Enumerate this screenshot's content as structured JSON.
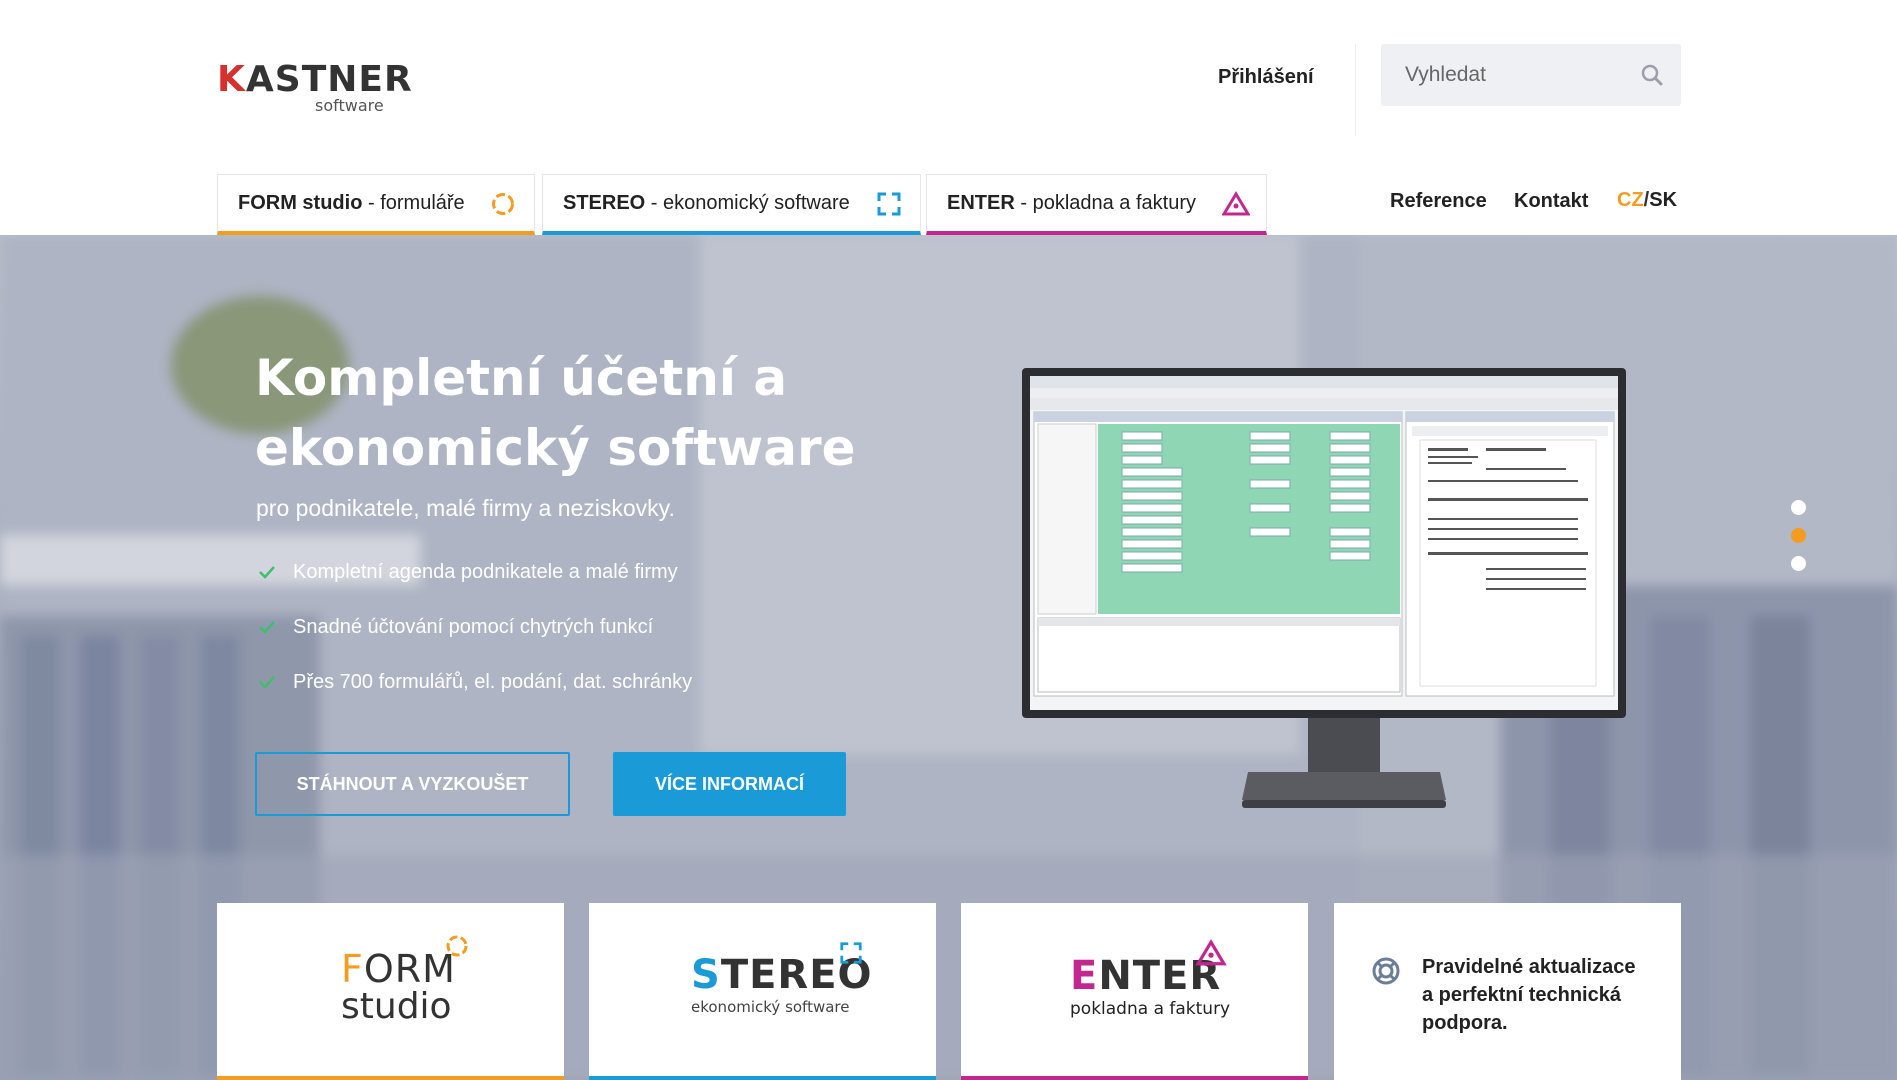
{
  "header": {
    "logo": {
      "main": "KASTNER",
      "sub": "software"
    },
    "login_label": "Přihlášení",
    "search": {
      "placeholder": "Vyhledat"
    }
  },
  "tabs": [
    {
      "name": "FORM studio",
      "desc": " - formuláře",
      "color": "#f39c1f",
      "icon": "ring-icon"
    },
    {
      "name": "STEREO",
      "desc": " - ekonomický software",
      "color": "#1a9ad6",
      "icon": "frame-corners-icon"
    },
    {
      "name": "ENTER",
      "desc": " - pokladna a faktury",
      "color": "#c2278f",
      "icon": "triangle-icon"
    }
  ],
  "nav": {
    "reference": "Reference",
    "contact": "Kontakt",
    "lang_cz": "CZ",
    "lang_sep": "/",
    "lang_sk": "SK"
  },
  "hero": {
    "title": "Kompletní účetní a ekonomický software",
    "subtitle": "pro podnikatele, malé firmy a neziskovky.",
    "features": [
      "Kompletní agenda podnikatele a malé firmy",
      "Snadné účtování pomocí chytrých funkcí",
      "Přes 700 formulářů, el. podání, dat. schránky"
    ],
    "btn_download": "STÁHNOUT A VYZKOUŠET",
    "btn_more": "VÍCE INFORMACÍ",
    "slider": {
      "count": 3,
      "active_index": 1
    }
  },
  "cards": {
    "form": {
      "logo_first": "F",
      "logo_rest": "ORM",
      "logo_sub": "studio"
    },
    "stereo": {
      "logo_first": "S",
      "logo_rest": "TEREO",
      "logo_sub": "ekonomický software"
    },
    "enter": {
      "logo_first": "E",
      "logo_rest": "NTER",
      "logo_sub": "pokladna a faktury"
    },
    "support": {
      "text": "Pravidelné aktualizace a perfektní technická podpora."
    }
  },
  "colors": {
    "form": "#f39c1f",
    "stereo": "#1a9ad6",
    "enter": "#c2278f",
    "kastner_red": "#d6312f"
  }
}
